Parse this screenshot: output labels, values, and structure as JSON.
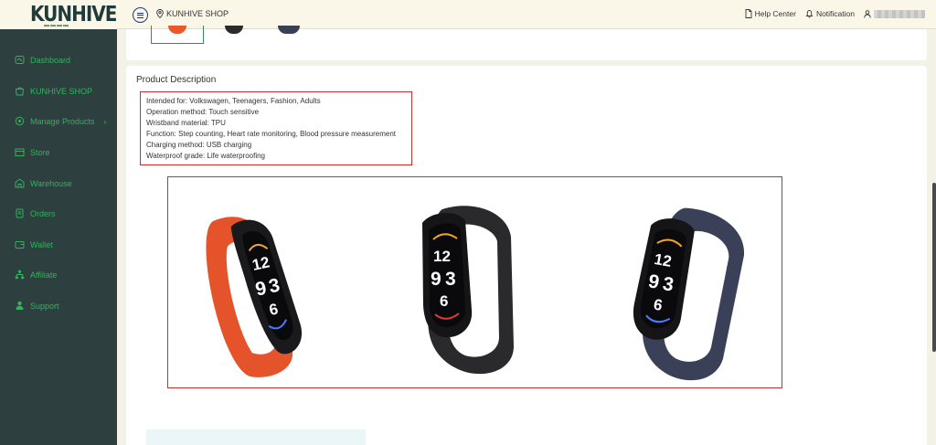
{
  "header": {
    "logo": "KUNHIVE",
    "shop_name": "KUNHIVE SHOP",
    "help_center": "Help Center",
    "notification": "Notification"
  },
  "sidebar": {
    "items": [
      {
        "label": "Dashboard",
        "icon": "dashboard-icon"
      },
      {
        "label": "KUNHIVE SHOP",
        "icon": "shop-bag-icon"
      },
      {
        "label": "Manage Products",
        "icon": "products-icon"
      },
      {
        "label": "Store",
        "icon": "store-icon"
      },
      {
        "label": "Warehouse",
        "icon": "warehouse-icon"
      },
      {
        "label": "Orders",
        "icon": "orders-icon"
      },
      {
        "label": "Wallet",
        "icon": "wallet-icon"
      },
      {
        "label": "Affiliate",
        "icon": "affiliate-icon"
      },
      {
        "label": "Support",
        "icon": "support-icon"
      }
    ]
  },
  "product": {
    "description_title": "Product Description",
    "specs": [
      "Intended for: Volkswagen, Teenagers, Fashion, Adults",
      "Operation method: Touch sensitive",
      "Wristband material: TPU",
      "Function: Step counting, Heart rate monitoring, Blood pressure measurement",
      "Charging method: USB charging",
      "Waterproof grade: Life waterproofing"
    ],
    "watch_time_hour": "12",
    "watch_time_minute": "9",
    "watch_time_second": "3",
    "watch_time_bottom": "6",
    "band_colors": [
      "#e4532a",
      "#2a2a2c",
      "#3a4058"
    ]
  },
  "colors": {
    "sidebar_bg": "#2e3f3f",
    "accent_green": "#2fb45a",
    "highlight_red": "#d42a2a"
  }
}
